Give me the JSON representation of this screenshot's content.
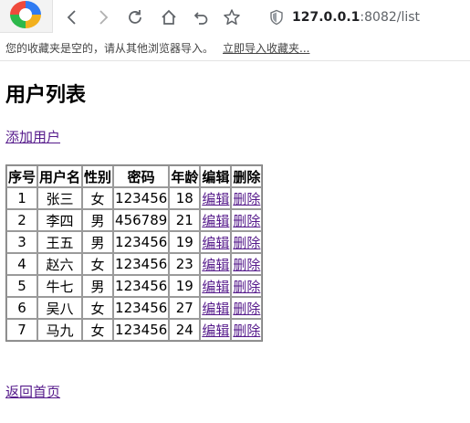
{
  "browser": {
    "url_host": "127.0.0.1",
    "url_rest": ":8082/list",
    "bookmarks_notice": "您的收藏夹是空的，请从其他浏览器导入。",
    "import_link": "立即导入收藏夹..."
  },
  "page": {
    "title": "用户列表",
    "add_link": "添加用户",
    "back_link": "返回首页"
  },
  "table": {
    "headers": {
      "id": "序号",
      "username": "用户名",
      "gender": "性别",
      "password": "密码",
      "age": "年龄",
      "edit": "编辑",
      "delete": "删除"
    },
    "rows": [
      {
        "id": "1",
        "username": "张三",
        "gender": "女",
        "password": "123456",
        "age": "18",
        "edit": "编辑",
        "delete": "删除"
      },
      {
        "id": "2",
        "username": "李四",
        "gender": "男",
        "password": "456789",
        "age": "21",
        "edit": "编辑",
        "delete": "删除"
      },
      {
        "id": "3",
        "username": "王五",
        "gender": "男",
        "password": "123456",
        "age": "19",
        "edit": "编辑",
        "delete": "删除"
      },
      {
        "id": "4",
        "username": "赵六",
        "gender": "女",
        "password": "123456",
        "age": "23",
        "edit": "编辑",
        "delete": "删除"
      },
      {
        "id": "5",
        "username": "牛七",
        "gender": "男",
        "password": "123456",
        "age": "19",
        "edit": "编辑",
        "delete": "删除"
      },
      {
        "id": "6",
        "username": "吴八",
        "gender": "女",
        "password": "123456",
        "age": "27",
        "edit": "编辑",
        "delete": "删除"
      },
      {
        "id": "7",
        "username": "马九",
        "gender": "女",
        "password": "123456",
        "age": "24",
        "edit": "编辑",
        "delete": "删除"
      }
    ]
  }
}
